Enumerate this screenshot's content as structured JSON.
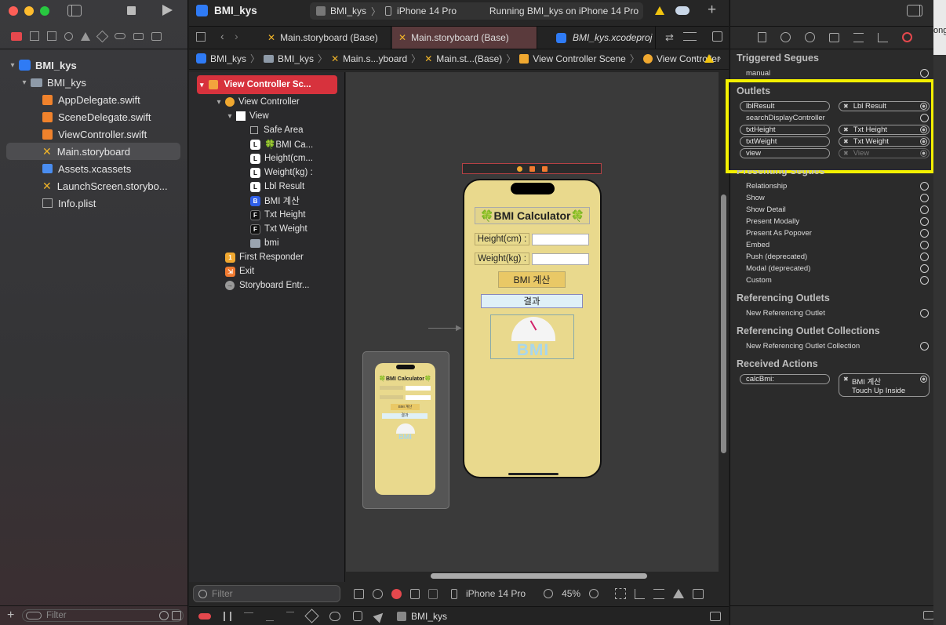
{
  "window": {
    "project": "BMI_kys"
  },
  "toolbar": {
    "scheme_target": "BMI_kys",
    "scheme_device": "iPhone 14 Pro",
    "status": "Running BMI_kys on iPhone 14 Pro"
  },
  "navigator": {
    "items": [
      {
        "label": "BMI_kys",
        "icon": "project-icon"
      },
      {
        "label": "BMI_kys",
        "icon": "folder-icon"
      },
      {
        "label": "AppDelegate.swift",
        "icon": "swift-icon"
      },
      {
        "label": "SceneDelegate.swift",
        "icon": "swift-icon"
      },
      {
        "label": "ViewController.swift",
        "icon": "swift-icon"
      },
      {
        "label": "Main.storyboard",
        "icon": "storyboard-icon"
      },
      {
        "label": "Assets.xcassets",
        "icon": "assets-icon"
      },
      {
        "label": "LaunchScreen.storybo...",
        "icon": "storyboard-icon"
      },
      {
        "label": "Info.plist",
        "icon": "plist-icon"
      }
    ],
    "filter_placeholder": "Filter"
  },
  "tabs": [
    {
      "label": "Main.storyboard (Base)"
    },
    {
      "label": "Main.storyboard (Base)"
    },
    {
      "label": "BMI_kys.xcodeproj"
    }
  ],
  "breadcrumb": [
    "BMI_kys",
    "BMI_kys",
    "Main.s...yboard",
    "Main.st...(Base)",
    "View Controller Scene",
    "View Controller"
  ],
  "outline": {
    "scene": "View Controller Sc...",
    "items": [
      {
        "label": "View Controller",
        "badge": ""
      },
      {
        "label": "View",
        "badge": ""
      },
      {
        "label": "Safe Area",
        "badge": ""
      },
      {
        "label": "🍀BMI Ca...",
        "badge": "L"
      },
      {
        "label": "Height(cm...",
        "badge": "L"
      },
      {
        "label": "Weight(kg) :",
        "badge": "L"
      },
      {
        "label": "Lbl Result",
        "badge": "L"
      },
      {
        "label": "BMI 계산",
        "badge": "B"
      },
      {
        "label": "Txt Height",
        "badge": "F"
      },
      {
        "label": "Txt Weight",
        "badge": "F"
      },
      {
        "label": "bmi",
        "badge": ""
      },
      {
        "label": "First Responder",
        "badge": "1"
      },
      {
        "label": "Exit",
        "badge": ""
      },
      {
        "label": "Storyboard Entr...",
        "badge": ""
      }
    ],
    "filter_placeholder": "Filter"
  },
  "phone": {
    "title": "🍀BMI Calculator🍀",
    "height_label": "Height(cm) :",
    "weight_label": "Weight(kg) :",
    "button": "BMI 계산",
    "result": "결과",
    "image_text": "BMI"
  },
  "mini_phone": {
    "title": "🍀BMI Calculator🍀",
    "button": "BMI 계산",
    "result": "결과",
    "image_text": "BMI"
  },
  "canvas_bar": {
    "device": "iPhone 14 Pro",
    "zoom": "45%"
  },
  "debug_bar": {
    "target": "BMI_kys"
  },
  "inspector": {
    "triggered_segues": {
      "title": "Triggered Segues",
      "items": [
        "manual"
      ]
    },
    "outlets": {
      "title": "Outlets",
      "items": [
        {
          "name": "lblResult",
          "target": "Lbl Result",
          "connected": true
        },
        {
          "name": "searchDisplayController",
          "target": "",
          "connected": false
        },
        {
          "name": "txtHeight",
          "target": "Txt Height",
          "connected": true
        },
        {
          "name": "txtWeight",
          "target": "Txt Weight",
          "connected": true
        },
        {
          "name": "view",
          "target": "View",
          "connected": true
        }
      ]
    },
    "presenting_segues": {
      "title": "Presenting Segues",
      "items": [
        "Relationship",
        "Show",
        "Show Detail",
        "Present Modally",
        "Present As Popover",
        "Embed",
        "Push (deprecated)",
        "Modal (deprecated)",
        "Custom"
      ]
    },
    "referencing_outlets": {
      "title": "Referencing Outlets",
      "items": [
        "New Referencing Outlet"
      ]
    },
    "referencing_collections": {
      "title": "Referencing Outlet Collections",
      "items": [
        "New Referencing Outlet Collection"
      ]
    },
    "received_actions": {
      "title": "Received Actions",
      "action": "calcBmi:",
      "target": "BMI 계산",
      "event": "Touch Up Inside"
    },
    "highlight_color": "#f3f000"
  },
  "right_edge_text": "ong"
}
